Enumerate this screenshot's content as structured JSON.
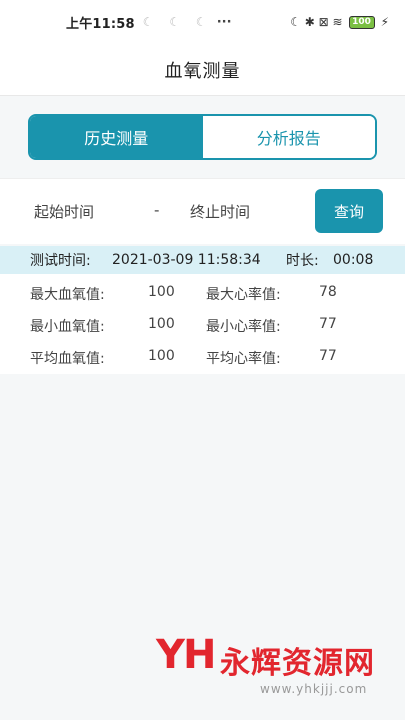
{
  "status_bar": {
    "time": "上午11:58",
    "glyphs": "☾ ☾ ☾",
    "more": "···",
    "icons": "☾ ✱ ⊠ ≋",
    "battery": "100",
    "charge": "⚡"
  },
  "header": {
    "title": "血氧测量"
  },
  "tabs": [
    {
      "label": "历史测量",
      "active": true
    },
    {
      "label": "分析报告",
      "active": false
    }
  ],
  "query": {
    "start_label": "起始时间",
    "separator": "-",
    "end_label": "终止时间",
    "button_label": "查询"
  },
  "record": {
    "time_label": "测试时间:",
    "datetime": "2021-03-09 11:58:34",
    "duration_label": "时长:",
    "duration": "00:08",
    "stats": [
      {
        "label": "最大血氧值:",
        "value": "100",
        "label2": "最大心率值:",
        "value2": "78"
      },
      {
        "label": "最小血氧值:",
        "value": "100",
        "label2": "最小心率值:",
        "value2": "77"
      },
      {
        "label": "平均血氧值:",
        "value": "100",
        "label2": "平均心率值:",
        "value2": "77"
      }
    ]
  },
  "watermark": {
    "logo": "YH",
    "name": "永辉资源网",
    "url": "www.yhkjjj.com"
  },
  "colors": {
    "accent": "#1a94ad",
    "header_row_bg": "#d9f0f6",
    "watermark": "#e2262e"
  }
}
